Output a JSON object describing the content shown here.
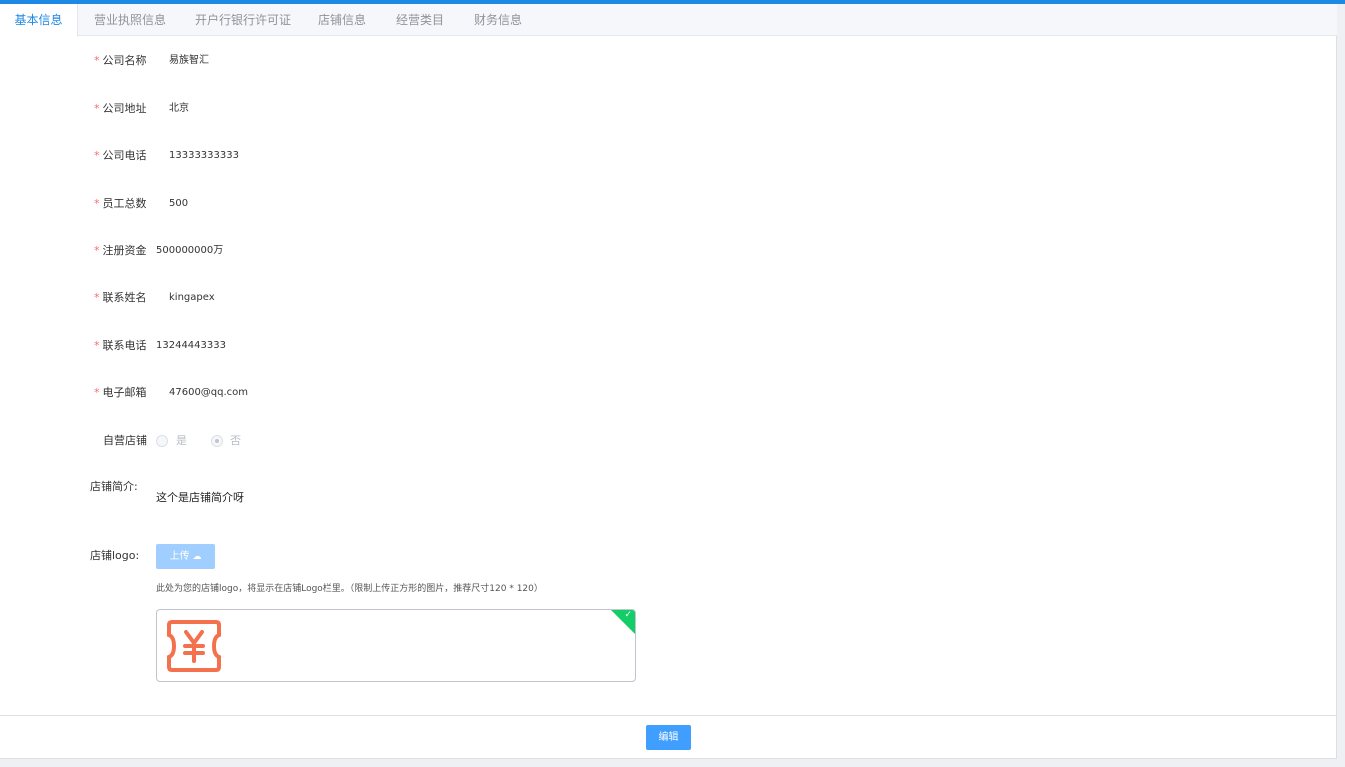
{
  "tabs": [
    {
      "label": "基本信息",
      "active": true
    },
    {
      "label": "营业执照信息"
    },
    {
      "label": "开户行银行许可证"
    },
    {
      "label": "店铺信息"
    },
    {
      "label": "经营类目"
    },
    {
      "label": "财务信息"
    }
  ],
  "form": {
    "company_name": {
      "label": "公司名称",
      "value": "易族智汇"
    },
    "company_address": {
      "label": "公司地址",
      "value": "北京"
    },
    "company_phone": {
      "label": "公司电话",
      "value": "13333333333"
    },
    "employee_count": {
      "label": "员工总数",
      "value": "500"
    },
    "registered_capital": {
      "label": "注册资金",
      "value": "500000000万"
    },
    "contact_name": {
      "label": "联系姓名",
      "value": "kingapex"
    },
    "contact_phone": {
      "label": "联系电话",
      "value": "13244443333"
    },
    "email": {
      "label": "电子邮箱",
      "value": "47600@qq.com"
    },
    "self_operated": {
      "label": "自营店铺",
      "option_yes": "是",
      "option_no": "否",
      "selected": "否"
    },
    "store_intro": {
      "label": "店铺简介:",
      "value": "这个是店铺简介呀"
    },
    "store_logo": {
      "label": "店铺logo:",
      "upload_label": "上传",
      "hint": "此处为您的店铺logo，将显示在店铺Logo栏里。（限制上传正方形的图片，推荐尺寸120 * 120）"
    }
  },
  "footer": {
    "edit_label": "编辑"
  },
  "required_mark": "*",
  "icons": {
    "upload": "cloud-upload-icon",
    "check": "check-icon",
    "logo": "yen-coupon-icon"
  },
  "colors": {
    "accent": "#1e88e5",
    "primary": "#409eff",
    "success": "#13ce66",
    "required": "#f56c6c",
    "logo": "#f4714d"
  }
}
